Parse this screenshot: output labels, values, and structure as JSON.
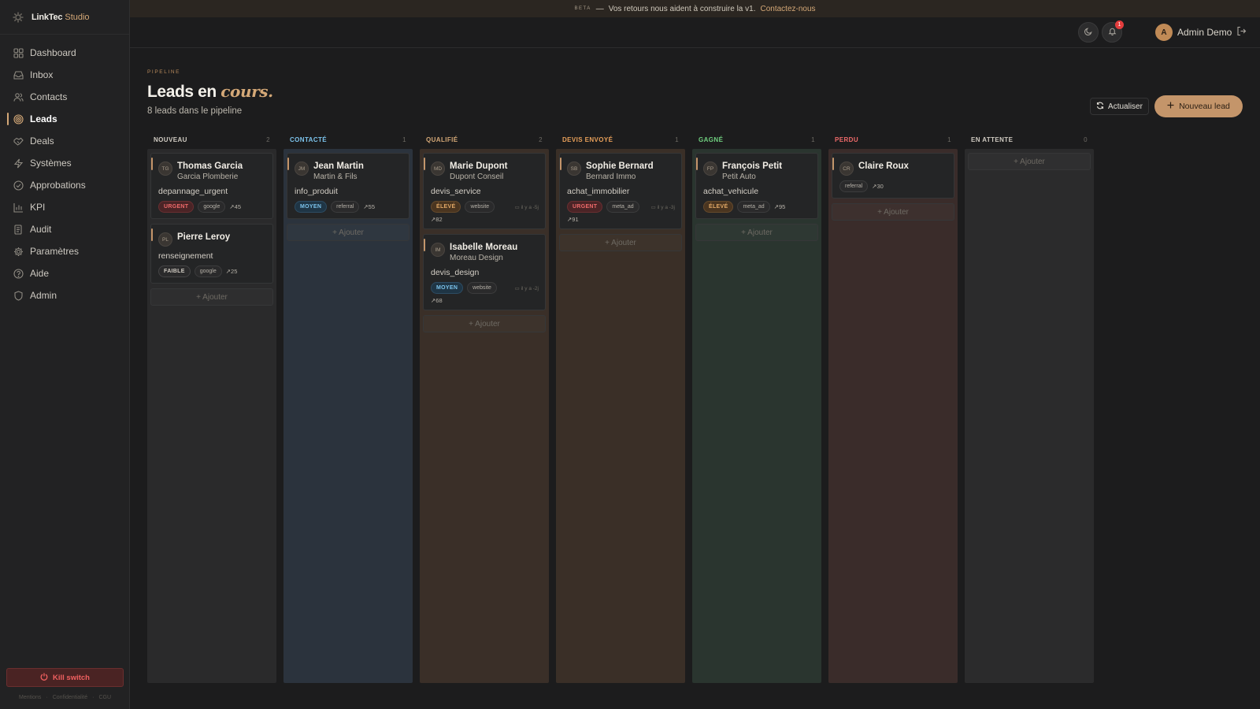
{
  "brand": {
    "name": "LinkTec",
    "accent": "Studio"
  },
  "beta": {
    "tag": "BETA",
    "dash": "—",
    "message": "Vos retours nous aident à construire la v1.",
    "link": "Contactez-nous"
  },
  "sidebar": {
    "items": [
      {
        "label": "Dashboard",
        "icon": "grid-icon"
      },
      {
        "label": "Inbox",
        "icon": "inbox-icon"
      },
      {
        "label": "Contacts",
        "icon": "users-icon"
      },
      {
        "label": "Leads",
        "icon": "target-icon",
        "active": true
      },
      {
        "label": "Deals",
        "icon": "handshake-icon"
      },
      {
        "label": "Systèmes",
        "icon": "bolt-icon"
      },
      {
        "label": "Approbations",
        "icon": "check-circle-icon"
      },
      {
        "label": "KPI",
        "icon": "bar-chart-icon"
      },
      {
        "label": "Audit",
        "icon": "scroll-icon"
      },
      {
        "label": "Paramètres",
        "icon": "gear-icon"
      },
      {
        "label": "Aide",
        "icon": "help-circle-icon"
      },
      {
        "label": "Admin",
        "icon": "shield-icon"
      }
    ],
    "kill_switch": "Kill switch",
    "footer": [
      "Mentions",
      "·",
      "Confidentialité",
      "·",
      "CGU"
    ]
  },
  "topbar": {
    "notifications": "1",
    "avatar_initial": "A",
    "user_name": "Admin Demo"
  },
  "page": {
    "eyebrow": "PIPELINE",
    "title": "Leads en",
    "title_accent": "cours.",
    "subtitle": "8 leads dans le pipeline",
    "refresh_label": "Actualiser",
    "new_label": "Nouveau lead"
  },
  "add_label": "+ Ajouter",
  "columns": [
    {
      "title": "NOUVEAU",
      "count": "2",
      "color": "#d0cbc2",
      "bg": "#2a2a2b",
      "cards": [
        {
          "initials": "TG",
          "name": "Thomas Garcia",
          "company": "Garcia Plomberie",
          "intent": "depannage_urgent",
          "priority": "URGENT",
          "priority_class": "urgent",
          "source": "google",
          "score": "↗45",
          "date": "",
          "accent": "#c4956a"
        },
        {
          "initials": "PL",
          "name": "Pierre Leroy",
          "company": "",
          "intent": "renseignement",
          "priority": "FAIBLE",
          "priority_class": "faible",
          "source": "google",
          "score": "↗25",
          "date": "",
          "accent": "#c4956a"
        }
      ]
    },
    {
      "title": "CONTACTÉ",
      "count": "1",
      "color": "#7cc3ec",
      "bg": "#2b333d",
      "cards": [
        {
          "initials": "JM",
          "name": "Jean Martin",
          "company": "Martin & Fils",
          "intent": "info_produit",
          "priority": "MOYEN",
          "priority_class": "moyen",
          "source": "referral",
          "score": "↗55",
          "date": "",
          "accent": "#c4956a"
        }
      ]
    },
    {
      "title": "QUALIFIÉ",
      "count": "2",
      "color": "#d4a877",
      "bg": "#3a2f28",
      "cards": [
        {
          "initials": "MD",
          "name": "Marie Dupont",
          "company": "Dupont Conseil",
          "intent": "devis_service",
          "priority": "ÉLEVÉ",
          "priority_class": "eleve",
          "source": "website",
          "score": "↗82",
          "date": "il y a -5j",
          "accent": "#c4956a"
        },
        {
          "initials": "IM",
          "name": "Isabelle Moreau",
          "company": "Moreau Design",
          "intent": "devis_design",
          "priority": "MOYEN",
          "priority_class": "moyen",
          "source": "website",
          "score": "↗68",
          "date": "il y a -2j",
          "accent": "#c4956a"
        }
      ]
    },
    {
      "title": "DEVIS ENVOYÉ",
      "count": "1",
      "color": "#e8a05a",
      "bg": "#3a2f27",
      "cards": [
        {
          "initials": "SB",
          "name": "Sophie Bernard",
          "company": "Bernard Immo",
          "intent": "achat_immobilier",
          "priority": "URGENT",
          "priority_class": "urgent",
          "source": "meta_ad",
          "score": "↗91",
          "date": "il y a -3j",
          "accent": "#c4956a"
        }
      ]
    },
    {
      "title": "GAGNÉ",
      "count": "1",
      "color": "#6fcf7f",
      "bg": "#2a352f",
      "cards": [
        {
          "initials": "FP",
          "name": "François Petit",
          "company": "Petit Auto",
          "intent": "achat_vehicule",
          "priority": "ÉLEVÉ",
          "priority_class": "eleve",
          "source": "meta_ad",
          "score": "↗95",
          "date": "",
          "accent": "#c4956a"
        }
      ]
    },
    {
      "title": "PERDU",
      "count": "1",
      "color": "#ef6a6a",
      "bg": "#3a2c2a",
      "cards": [
        {
          "initials": "CR",
          "name": "Claire Roux",
          "company": "",
          "intent": "",
          "priority": "",
          "priority_class": "",
          "source": "referral",
          "score": "↗30",
          "date": "",
          "accent": "#c4956a"
        }
      ]
    },
    {
      "title": "EN ATTENTE",
      "count": "0",
      "color": "#cfcac1",
      "bg": "#2b2b2c",
      "cards": []
    }
  ],
  "colors": {
    "accent": "#d4a877",
    "background": "#1c1c1d",
    "sidebar": "#222223",
    "danger": "#ef6a6a"
  }
}
